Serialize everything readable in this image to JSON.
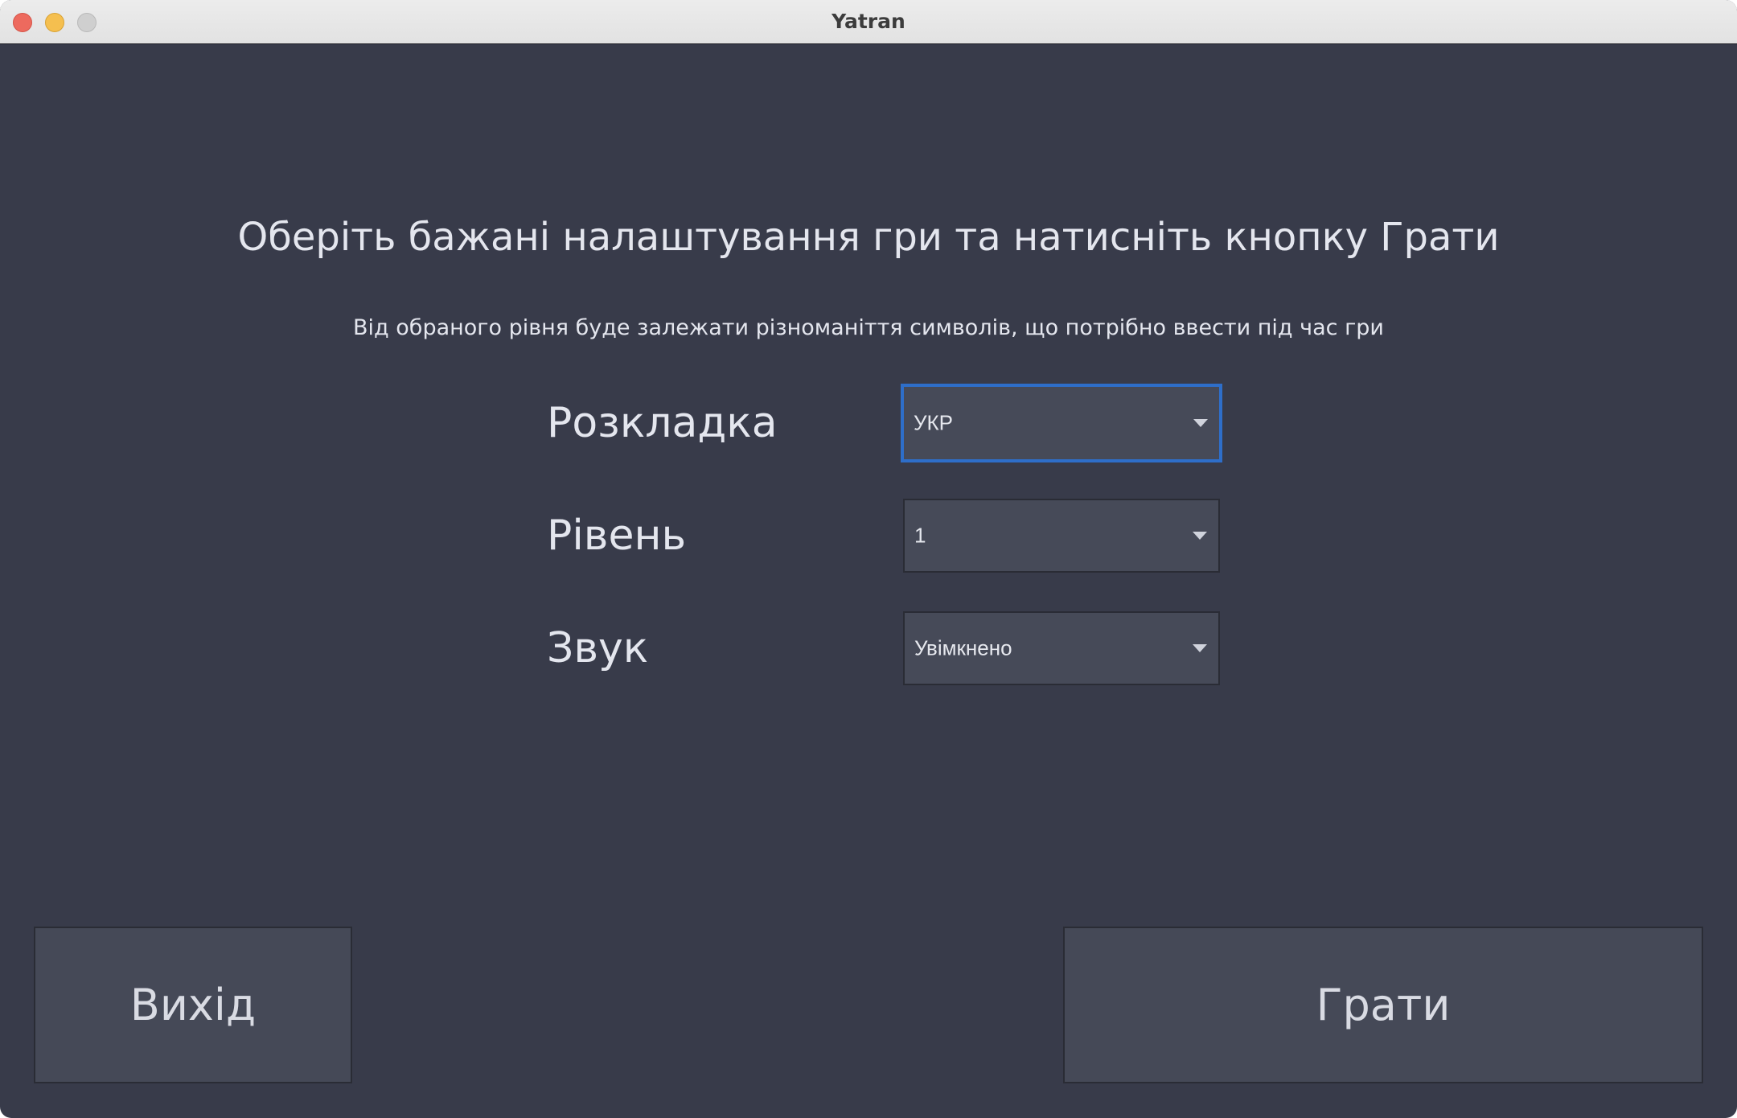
{
  "window": {
    "title": "Yatran"
  },
  "main": {
    "heading": "Оберіть бажані налаштування гри та натисніть кнопку Грати",
    "subheading": "Від обраного рівня буде залежати різноманіття символів, що потрібно ввести під час гри"
  },
  "settings": {
    "layout": {
      "label": "Розкладка",
      "value": "УКР"
    },
    "level": {
      "label": "Рівень",
      "value": "1"
    },
    "sound": {
      "label": "Звук",
      "value": "Увімкнено"
    }
  },
  "buttons": {
    "exit_label": "Вихід",
    "play_label": "Грати"
  },
  "colors": {
    "background": "#383b4a",
    "control": "#464a58",
    "focus": "#2e6ec9",
    "text": "#e4e6ee"
  },
  "icons": {
    "dropdown": "chevron-down-icon",
    "close": "close-icon",
    "minimize": "minimize-icon",
    "zoom": "zoom-icon"
  }
}
